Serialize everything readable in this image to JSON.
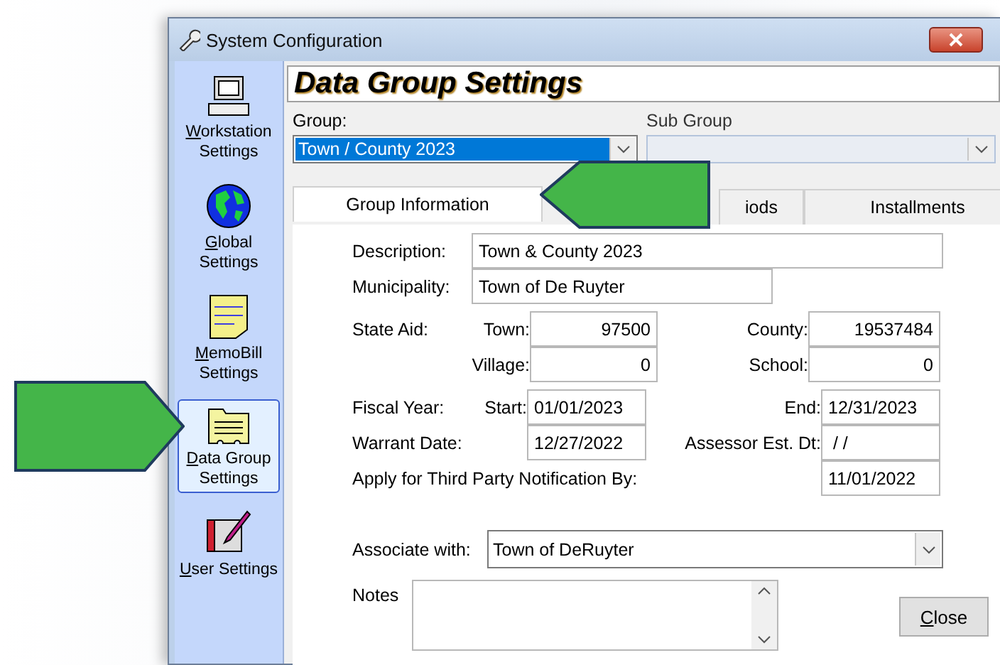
{
  "window": {
    "title": "System Configuration"
  },
  "sidebar": {
    "items": [
      {
        "label": "Workstation Settings",
        "kind": "computer",
        "selected": false
      },
      {
        "label": "Global Settings",
        "kind": "globe",
        "selected": false
      },
      {
        "label": "MemoBill Settings",
        "kind": "note",
        "selected": false
      },
      {
        "label": "Data Group Settings",
        "kind": "folder",
        "selected": true
      },
      {
        "label": "User Settings",
        "kind": "notebook",
        "selected": false
      }
    ]
  },
  "header": "Data Group Settings",
  "group": {
    "label": "Group:",
    "value": "Town / County 2023"
  },
  "sub_group": {
    "label": "Sub Group",
    "disabled": true
  },
  "tabs": [
    {
      "label": "Group Information",
      "selected": true
    },
    {
      "label": "iods",
      "selected": false
    },
    {
      "label": "Installments",
      "selected": false
    }
  ],
  "form": {
    "description_label": "Description:",
    "description": "Town & County 2023",
    "municipality_label": "Municipality:",
    "municipality": "Town of De Ruyter",
    "state_aid_label": "State Aid:",
    "town_label": "Town:",
    "town": "97500",
    "county_label": "County:",
    "county": "19537484",
    "village_label": "Village:",
    "village": "0",
    "school_label": "School:",
    "school": "0",
    "fiscal_year_label": "Fiscal Year:",
    "start_label": "Start:",
    "start": "01/01/2023",
    "end_label": "End:",
    "end": "12/31/2023",
    "warrant_label": "Warrant Date:",
    "warrant": "12/27/2022",
    "assessor_label": "Assessor Est. Dt:",
    "assessor": " / /",
    "third_party_label": "Apply for Third Party Notification By:",
    "third_party": "11/01/2022",
    "associate_label": "Associate with:",
    "associate": "Town of DeRuyter",
    "notes_label": "Notes"
  },
  "close_button": "Close",
  "annotations": [
    {
      "kind": "right"
    },
    {
      "kind": "left"
    }
  ]
}
